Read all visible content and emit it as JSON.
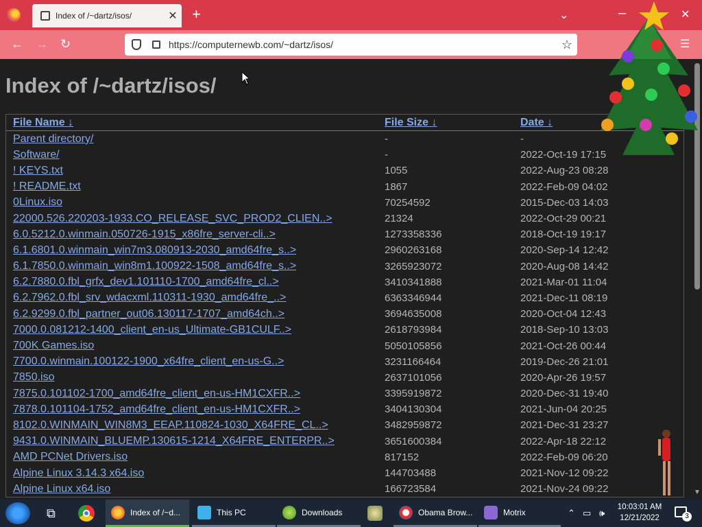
{
  "browser": {
    "tab_title": "Index of /~dartz/isos/",
    "url": "https://computernewb.com/~dartz/isos/",
    "accent_color": "#d83a4a"
  },
  "page": {
    "title": "Index of /~dartz/isos/",
    "columns": {
      "name": "File Name",
      "size": "File Size",
      "date": "Date",
      "sort_indicator": "↓"
    },
    "rows": [
      {
        "name": "Parent directory/",
        "size": "-",
        "date": "-"
      },
      {
        "name": "Software/",
        "size": "-",
        "date": "2022-Oct-19 17:15"
      },
      {
        "name": "! KEYS.txt",
        "size": "1055",
        "date": "2022-Aug-23 08:28"
      },
      {
        "name": "! README.txt",
        "size": "1867",
        "date": "2022-Feb-09 04:02"
      },
      {
        "name": "0Linux.iso",
        "size": "70254592",
        "date": "2015-Dec-03 14:03"
      },
      {
        "name": "22000.526.220203-1933.CO_RELEASE_SVC_PROD2_CLIEN..>",
        "size": "21324",
        "date": "2022-Oct-29 00:21"
      },
      {
        "name": "6.0.5212.0.winmain.050726-1915_x86fre_server-cli..>",
        "size": "1273358336",
        "date": "2018-Oct-19 19:17"
      },
      {
        "name": "6.1.6801.0.winmain_win7m3.080913-2030_amd64fre_s..>",
        "size": "2960263168",
        "date": "2020-Sep-14 12:42"
      },
      {
        "name": "6.1.7850.0.winmain_win8m1.100922-1508_amd64fre_s..>",
        "size": "3265923072",
        "date": "2020-Aug-08 14:42"
      },
      {
        "name": "6.2.7880.0.fbl_grfx_dev1.101110-1700_amd64fre_cl..>",
        "size": "3410341888",
        "date": "2021-Mar-01 11:04"
      },
      {
        "name": "6.2.7962.0.fbl_srv_wdacxml.110311-1930_amd64fre_..>",
        "size": "6363346944",
        "date": "2021-Dec-11 08:19"
      },
      {
        "name": "6.2.9299.0.fbl_partner_out06.130117-1707_amd64ch..>",
        "size": "3694635008",
        "date": "2020-Oct-04 12:43"
      },
      {
        "name": "7000.0.081212-1400_client_en-us_Ultimate-GB1CULF..>",
        "size": "2618793984",
        "date": "2018-Sep-10 13:03"
      },
      {
        "name": "700K Games.iso",
        "size": "5050105856",
        "date": "2021-Oct-26 00:44"
      },
      {
        "name": "7700.0.winmain.100122-1900_x64fre_client_en-us-G..>",
        "size": "3231166464",
        "date": "2019-Dec-26 21:01"
      },
      {
        "name": "7850.iso",
        "size": "2637101056",
        "date": "2020-Apr-26 19:57"
      },
      {
        "name": "7875.0.101102-1700_amd64fre_client_en-us-HM1CXFR..>",
        "size": "3395919872",
        "date": "2020-Dec-31 19:40"
      },
      {
        "name": "7878.0.101104-1752_amd64fre_client_en-us-HM1CXFR..>",
        "size": "3404130304",
        "date": "2021-Jun-04 20:25"
      },
      {
        "name": "8102.0.WINMAIN_WIN8M3_EEAP.110824-1030_X64FRE_CL..>",
        "size": "3482959872",
        "date": "2021-Dec-31 23:27"
      },
      {
        "name": "9431.0.WINMAIN_BLUEMP.130615-1214_X64FRE_ENTERPR..>",
        "size": "3651600384",
        "date": "2022-Apr-18 22:12"
      },
      {
        "name": "AMD PCNet Drivers.iso",
        "size": "817152",
        "date": "2022-Feb-09 06:20"
      },
      {
        "name": "Alpine Linux 3.14.3 x64.iso",
        "size": "144703488",
        "date": "2021-Nov-12 09:22"
      },
      {
        "name": "Alpine Linux x64.iso",
        "size": "166723584",
        "date": "2021-Nov-24 09:22"
      }
    ]
  },
  "taskbar": {
    "items": [
      {
        "label": "Index of /~d...",
        "icon": "firefox-icon",
        "state": "active"
      },
      {
        "label": "This PC",
        "icon": "this-pc-icon",
        "state": "open"
      },
      {
        "label": "Downloads",
        "icon": "downloads-icon",
        "state": "open"
      },
      {
        "label": "Obama Brow...",
        "icon": "obama-browser-icon",
        "state": "open"
      },
      {
        "label": "Motrix",
        "icon": "motrix-icon",
        "state": "open"
      }
    ],
    "time": "10:03:01 AM",
    "date": "12/21/2022",
    "notification_count": "3"
  }
}
